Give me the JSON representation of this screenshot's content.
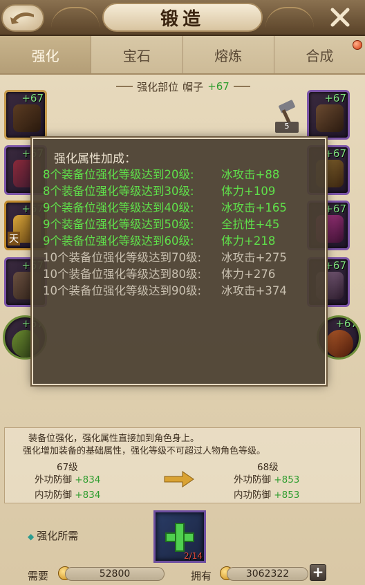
{
  "window": {
    "title": "锻造"
  },
  "tabs": [
    {
      "label": "强化",
      "active": true
    },
    {
      "label": "宝石",
      "active": false
    },
    {
      "label": "熔炼",
      "active": false
    },
    {
      "label": "合成",
      "active": false
    }
  ],
  "part": {
    "label": "强化部位",
    "name": "帽子",
    "level": "+67"
  },
  "slots": {
    "left": [
      "+67",
      "+67",
      "+67",
      "+67",
      "+67"
    ],
    "right": [
      "+67",
      "+67",
      "+67",
      "+67",
      "+67"
    ],
    "left_badge": "天"
  },
  "hammer": {
    "icon": "hammer-icon",
    "count": "5"
  },
  "popup": {
    "title": "强化属性加成：",
    "rows": [
      {
        "req": "8个装备位强化等级达到20级:",
        "bonus": "冰攻击+88",
        "active": true
      },
      {
        "req": "8个装备位强化等级达到30级:",
        "bonus": "体力+109",
        "active": true
      },
      {
        "req": "9个装备位强化等级达到40级:",
        "bonus": "冰攻击+165",
        "active": true
      },
      {
        "req": "9个装备位强化等级达到50级:",
        "bonus": "全抗性+45",
        "active": true
      },
      {
        "req": "9个装备位强化等级达到60级:",
        "bonus": "体力+218",
        "active": true
      },
      {
        "req": "10个装备位强化等级达到70级:",
        "bonus": "冰攻击+275",
        "active": false
      },
      {
        "req": "10个装备位强化等级达到80级:",
        "bonus": "体力+276",
        "active": false
      },
      {
        "req": "10个装备位强化等级达到90级:",
        "bonus": "冰攻击+374",
        "active": false
      }
    ]
  },
  "info": {
    "line1": "装备位强化，强化属性直接加到角色身上。",
    "line2": "强化增加装备的基础属性，强化等级不可超过人物角色等级。",
    "current": {
      "level": "67级",
      "outer_label": "外功防御",
      "outer_value": "+834",
      "inner_label": "内功防御",
      "inner_value": "+834"
    },
    "next": {
      "level": "68级",
      "outer_label": "外功防御",
      "outer_value": "+853",
      "inner_label": "内功防御",
      "inner_value": "+853"
    }
  },
  "requirements": {
    "label": "强化所需",
    "material_count": "2/14",
    "need_label": "需要",
    "need_value": "52800",
    "own_label": "拥有",
    "own_value": "3062322"
  },
  "colors": {
    "active_green": "#5fe04a",
    "inactive_gray": "#c9c0b0",
    "plus_green": "#2f9d2f"
  }
}
